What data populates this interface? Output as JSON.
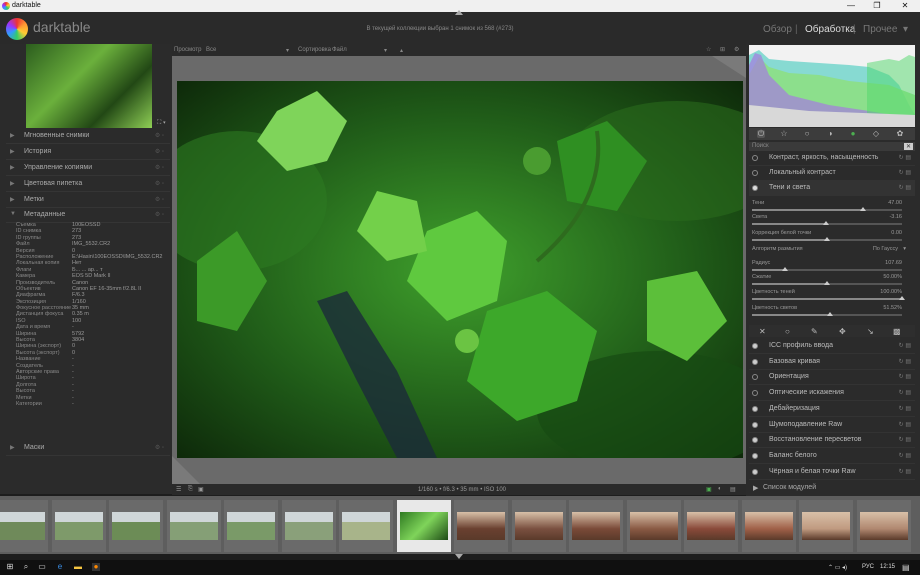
{
  "window": {
    "title": "darktable",
    "controls": [
      "—",
      "❐",
      "✕"
    ]
  },
  "header": {
    "app_name": "darktable",
    "collection_info": "В текущей коллекции выбран 1 снимок из 568 (#273)",
    "views": [
      "Обзор",
      "Обработка",
      "Прочее"
    ],
    "active_view": "Обработка",
    "separator": "|",
    "dropdown": "▾"
  },
  "toolbar": {
    "show_label": "Просмотр",
    "show_value": "Все",
    "sort_label": "Сортировка",
    "sort_value": "Файл",
    "icons": [
      "star-icon",
      "settings-icon"
    ]
  },
  "left_panel": {
    "nav_icons": "⛶ ▾",
    "modules": [
      {
        "label": "Мгновенные снимки",
        "expanded": false
      },
      {
        "label": "История",
        "expanded": false
      },
      {
        "label": "Управление копиями",
        "expanded": false
      },
      {
        "label": "Цветовая пипетка",
        "expanded": false
      },
      {
        "label": "Метки",
        "expanded": false
      },
      {
        "label": "Метаданные",
        "expanded": true
      }
    ],
    "metadata": [
      {
        "k": "Съемка",
        "v": "100EOSSD"
      },
      {
        "k": "ID снимка",
        "v": "273"
      },
      {
        "k": "ID группы",
        "v": "273"
      },
      {
        "k": "Файл",
        "v": "IMG_5532.CR2"
      },
      {
        "k": "Версия",
        "v": "0"
      },
      {
        "k": "Расположение",
        "v": "E:\\Hasin\\100EOSSD\\IMG_5532.CR2"
      },
      {
        "k": "Локальная копия",
        "v": "Нет"
      },
      {
        "k": "Флаги",
        "v": "Б... ... ар... т"
      },
      {
        "k": "Камера",
        "v": "EOS 5D Mark II"
      },
      {
        "k": "Производитель",
        "v": "Canon"
      },
      {
        "k": "Объектив",
        "v": "Canon EF 16-35mm f/2.8L II"
      },
      {
        "k": "Диафрагма",
        "v": "F/6.3"
      },
      {
        "k": "Экспозиция",
        "v": "1/160"
      },
      {
        "k": "Фокусное расстояние",
        "v": "35 mm"
      },
      {
        "k": "Дистанция фокуса",
        "v": "0.35 m"
      },
      {
        "k": "ISO",
        "v": "100"
      },
      {
        "k": "Дата и время",
        "v": "-"
      },
      {
        "k": "Ширина",
        "v": "5792"
      },
      {
        "k": "Высота",
        "v": "3804"
      },
      {
        "k": "Ширина (экспорт)",
        "v": "0"
      },
      {
        "k": "Высота (экспорт)",
        "v": "0"
      },
      {
        "k": "Название",
        "v": "-"
      },
      {
        "k": "Создатель",
        "v": "-"
      },
      {
        "k": "Авторские права",
        "v": "-"
      },
      {
        "k": "Широта",
        "v": "-"
      },
      {
        "k": "Долгота",
        "v": "-"
      },
      {
        "k": "Высота",
        "v": "-"
      },
      {
        "k": "Метки",
        "v": "-"
      },
      {
        "k": "Категории",
        "v": "-"
      }
    ],
    "masks_label": "Маски"
  },
  "bottombar": {
    "exif": "1/160 s • f/6.3 • 35 mm • ISO 100"
  },
  "right_panel": {
    "search_placeholder": "Поиск",
    "modules_top": [
      {
        "label": "Контраст, яркость, насыщенность"
      },
      {
        "label": "Локальный контраст"
      },
      {
        "label": "Тени и света"
      }
    ],
    "sliders": [
      {
        "label": "Тени",
        "value": "47.00",
        "level": 0.74
      },
      {
        "label": "Света",
        "value": "-3.16",
        "level": 0.49
      },
      {
        "label": "Коррекция белой точки",
        "value": "0.00",
        "level": 0.5
      },
      {
        "label": "Радиус",
        "value": "107.69",
        "level": 0.22
      },
      {
        "label": "Сжатие",
        "value": "50.00%",
        "level": 0.5
      },
      {
        "label": "Цветность теней",
        "value": "100.00%",
        "level": 1.0
      },
      {
        "label": "Цветность светов",
        "value": "51.52%",
        "level": 0.52
      }
    ],
    "algorithm_label": "Алгоритм размытия",
    "algorithm_value": "По Гауссу",
    "modules_bottom": [
      {
        "label": "ICC профиль ввода"
      },
      {
        "label": "Базовая кривая"
      },
      {
        "label": "Ориентация"
      },
      {
        "label": "Оптические искажения"
      },
      {
        "label": "Дебайеризация"
      },
      {
        "label": "Шумоподавление Raw"
      },
      {
        "label": "Восстановление пересветов"
      },
      {
        "label": "Баланс белого"
      },
      {
        "label": "Чёрная и белая точки Raw"
      }
    ],
    "module_list": "Список модулей"
  },
  "taskbar": {
    "lang": "РУС",
    "time": "12:15"
  },
  "colors": {
    "accent": "#f0f0f0",
    "panel": "#2b2b2b",
    "center_bg": "#6a6a6a"
  }
}
